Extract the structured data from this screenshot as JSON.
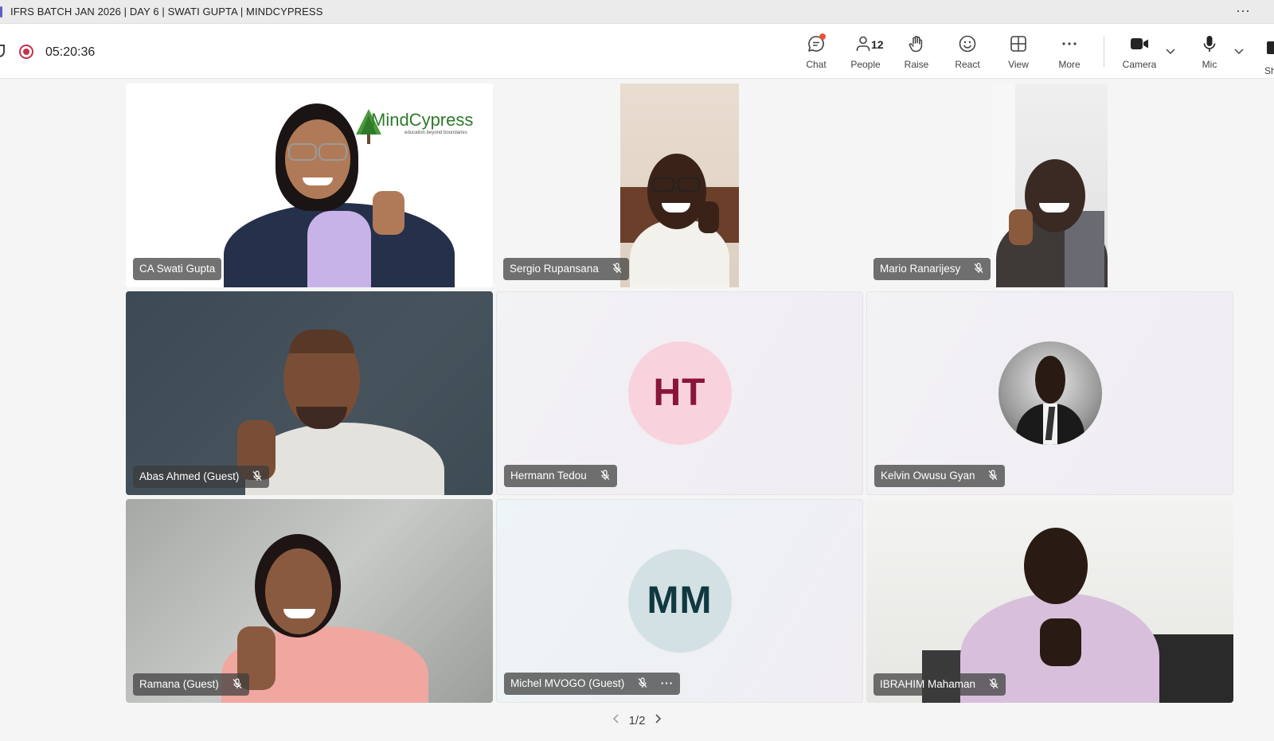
{
  "window": {
    "title": "IFRS BATCH JAN 2026 | DAY 6 | SWATI GUPTA | MINDCYPRESS",
    "more_label": "···"
  },
  "meeting": {
    "timer": "05:20:36"
  },
  "toolbar": {
    "chat": "Chat",
    "people": "People",
    "people_count": "12",
    "raise": "Raise",
    "react": "React",
    "view": "View",
    "more": "More",
    "camera": "Camera",
    "mic": "Mic",
    "share": "Sh"
  },
  "brand": {
    "logo_text": "MindCypress",
    "tagline": "education beyond boundaries",
    "accent": "#5b5fc7",
    "record_color": "#c4314b"
  },
  "participants": [
    {
      "name": "CA Swati Gupta",
      "muted": false,
      "type": "video"
    },
    {
      "name": "Sergio Rupansana",
      "muted": true,
      "type": "video"
    },
    {
      "name": "Mario Ranarijesy",
      "muted": true,
      "type": "video"
    },
    {
      "name": "Abas Ahmed (Guest)",
      "muted": true,
      "type": "video"
    },
    {
      "name": "Hermann Tedou",
      "muted": true,
      "type": "avatar",
      "initials": "HT",
      "avatar_bg": "#f8d3de",
      "avatar_fg": "#8a1538"
    },
    {
      "name": "Kelvin Owusu Gyan",
      "muted": true,
      "type": "photo"
    },
    {
      "name": "Ramana (Guest)",
      "muted": true,
      "type": "video"
    },
    {
      "name": "Michel MVOGO (Guest)",
      "muted": true,
      "type": "avatar",
      "initials": "MM",
      "avatar_bg": "#d4e1e4",
      "avatar_fg": "#10383f",
      "more": "···"
    },
    {
      "name": "IBRAHIM Mahaman",
      "muted": true,
      "type": "video"
    }
  ],
  "pager": {
    "label": "1/2"
  }
}
